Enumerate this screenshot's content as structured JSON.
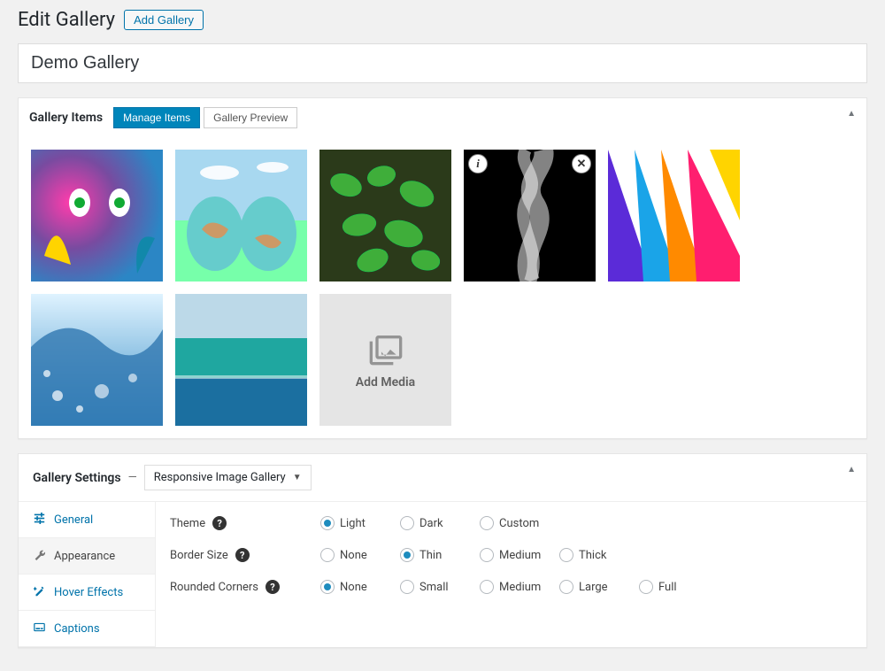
{
  "header": {
    "title": "Edit Gallery",
    "add_button": "Add Gallery"
  },
  "gallery_name": "Demo Gallery",
  "items_panel": {
    "title": "Gallery Items",
    "tabs": {
      "manage": "Manage Items",
      "preview": "Gallery Preview"
    },
    "add_media": "Add Media",
    "toggle": "▲"
  },
  "settings_panel": {
    "title": "Gallery Settings",
    "dash": "—",
    "select_value": "Responsive Image Gallery",
    "toggle": "▲",
    "tabs": {
      "general": "General",
      "appearance": "Appearance",
      "hover": "Hover Effects",
      "captions": "Captions"
    },
    "rows": {
      "theme": {
        "label": "Theme",
        "selected": "light",
        "options": {
          "light": "Light",
          "dark": "Dark",
          "custom": "Custom"
        }
      },
      "border": {
        "label": "Border Size",
        "selected": "thin",
        "options": {
          "none": "None",
          "thin": "Thin",
          "medium": "Medium",
          "thick": "Thick"
        }
      },
      "corners": {
        "label": "Rounded Corners",
        "selected": "none",
        "options": {
          "none": "None",
          "small": "Small",
          "medium": "Medium",
          "large": "Large",
          "full": "Full"
        }
      }
    }
  },
  "icons": {
    "info": "i",
    "close": "✕",
    "help": "?",
    "caret": "▼"
  }
}
